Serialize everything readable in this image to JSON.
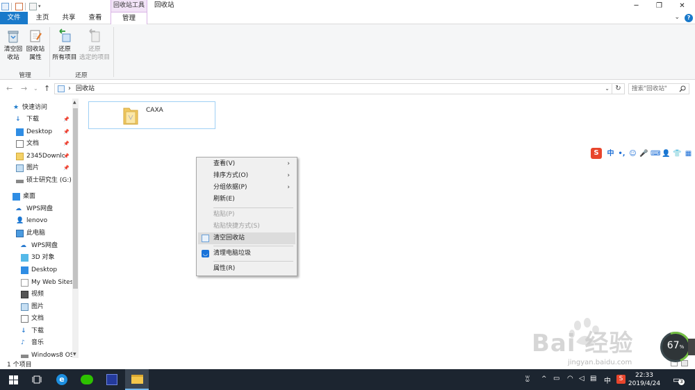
{
  "titlebar": {
    "ctx_tool_label": "回收站工具",
    "window_title": "回收站",
    "minimize": "─",
    "restore": "❐",
    "close": "✕"
  },
  "tabs": {
    "file": "文件",
    "home": "主页",
    "share": "共享",
    "view": "查看",
    "manage": "管理",
    "help": "?",
    "chevron": "⌄"
  },
  "ribbon": {
    "empty_bin": [
      "清空回",
      "收站"
    ],
    "bin_props": [
      "回收站",
      "属性"
    ],
    "group_manage": "管理",
    "restore_all": [
      "还原",
      "所有项目"
    ],
    "restore_selected": [
      "还原",
      "选定的项目"
    ],
    "group_restore": "还原"
  },
  "address": {
    "back": "←",
    "forward": "→",
    "recent": "⌄",
    "up": "↑",
    "crumb_sep": "›",
    "path": "回收站",
    "dropdown": "⌄",
    "refresh": "↻",
    "search_placeholder": "搜索\"回收站\"",
    "search_icon": "search-icon"
  },
  "nav": {
    "quick_access": "快速访问",
    "items": [
      {
        "label": "下载",
        "pinned": true
      },
      {
        "label": "Desktop",
        "pinned": true
      },
      {
        "label": "文档",
        "pinned": true
      },
      {
        "label": "2345Downlc",
        "pinned": true
      },
      {
        "label": "图片",
        "pinned": true
      },
      {
        "label": "硕士研究生 (G:)",
        "pinned": false
      }
    ],
    "desktop": "桌面",
    "wps": "WPS网盘",
    "lenovo": "lenovo",
    "this_pc": "此电脑",
    "pc_items": [
      "WPS网盘",
      "3D 对象",
      "Desktop",
      "My Web Sites",
      "视频",
      "图片",
      "文档",
      "下载",
      "音乐",
      "Windows8 OS"
    ],
    "pin_glyph": "📌"
  },
  "content": {
    "folder_name": "CAXA"
  },
  "status": {
    "count": "1 个项目"
  },
  "context_menu": {
    "items": [
      {
        "label": "查看(V)",
        "submenu": true,
        "enabled": true
      },
      {
        "label": "排序方式(O)",
        "submenu": true,
        "enabled": true
      },
      {
        "label": "分组依据(P)",
        "submenu": true,
        "enabled": true
      },
      {
        "label": "刷新(E)",
        "submenu": false,
        "enabled": true
      },
      {
        "label": "粘贴(P)",
        "submenu": false,
        "enabled": false
      },
      {
        "label": "粘贴快捷方式(S)",
        "submenu": false,
        "enabled": false
      },
      {
        "label": "清空回收站",
        "submenu": false,
        "enabled": true,
        "highlighted": true
      },
      {
        "label": "清理电脑垃圾",
        "submenu": false,
        "enabled": true
      },
      {
        "label": "属性(R)",
        "submenu": false,
        "enabled": true
      }
    ],
    "arrow": "›"
  },
  "ime": {
    "logo": "S",
    "lang": "中",
    "punct": "•,",
    "emoji": "☺",
    "mic": "🎤",
    "keyboard": "⌨",
    "user": "👤",
    "skin": "👕",
    "tools": "▦"
  },
  "watermark": {
    "main": "Bai 经验",
    "sub": "jingyan.baidu.com"
  },
  "gauge": {
    "value": "67",
    "unit": "%"
  },
  "taskbar": {
    "time": "22:33",
    "date": "2019/4/24",
    "lang": "中",
    "notif_count": "3",
    "tray_arrow": "^"
  },
  "colors": {
    "accent": "#1979ca",
    "ctx_tool": "#f2e3f7",
    "taskbar": "#1c2530"
  }
}
